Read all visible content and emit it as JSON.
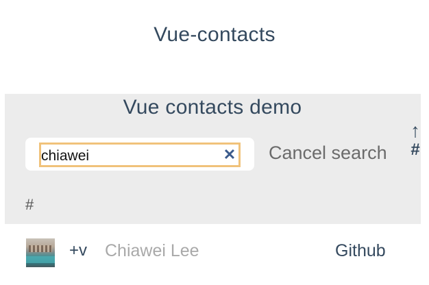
{
  "app": {
    "title": "Vue-contacts"
  },
  "demo": {
    "title": "Vue contacts demo",
    "search": {
      "value": "chiawei",
      "clear_icon": "close-icon"
    },
    "cancel_label": "Cancel search",
    "sort": {
      "arrow": "↑",
      "symbol": "#"
    },
    "section_letter": "#"
  },
  "contacts": [
    {
      "add_label": "+v",
      "name": "Chiawei Lee",
      "link_label": "Github",
      "avatar_icon": "photo-avatar"
    }
  ],
  "colors": {
    "title": "#34495e",
    "panel_bg": "#ececec",
    "input_border": "#f0c27a",
    "clear_icon": "#3a5a8c",
    "muted_text": "#a9a9a9"
  }
}
